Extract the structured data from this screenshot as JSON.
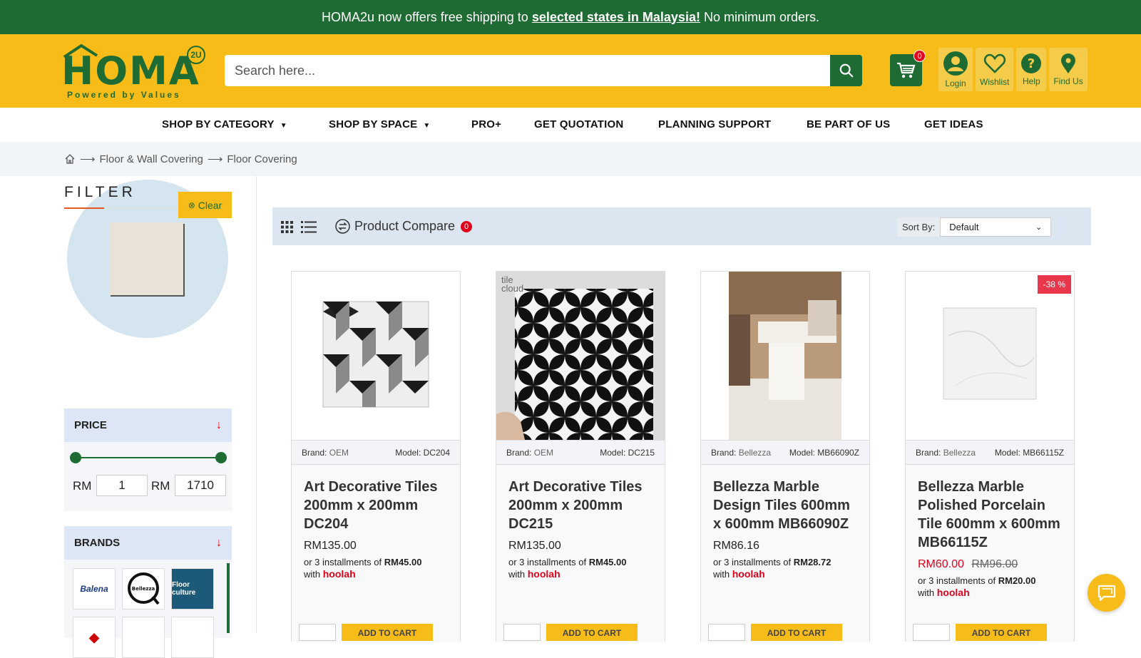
{
  "announcement": {
    "prefix": "HOMA2u now offers free shipping to",
    "link": "selected states in Malaysia!",
    "suffix": "No minimum orders."
  },
  "header": {
    "logo_text": "HOMA",
    "logo_badge": "2U",
    "logo_tagline": "Powered by Values",
    "search_placeholder": "Search here...",
    "cart_count": "0",
    "icons": [
      {
        "label": "Login",
        "icon": "user-icon"
      },
      {
        "label": "Wishlist",
        "icon": "heart-icon"
      },
      {
        "label": "Help",
        "icon": "help-icon"
      },
      {
        "label": "Find Us",
        "icon": "location-pin-icon"
      }
    ]
  },
  "nav": {
    "items": [
      "SHOP BY CATEGORY",
      "SHOP BY SPACE",
      "PRO+",
      "GET QUOTATION",
      "PLANNING SUPPORT",
      "BE PART OF US",
      "GET IDEAS"
    ]
  },
  "breadcrumb": [
    "Floor & Wall Covering",
    "Floor Covering"
  ],
  "filter": {
    "title": "FILTER",
    "clear": "Clear",
    "price": {
      "heading": "PRICE",
      "currency": "RM",
      "min": "1",
      "max": "1710"
    },
    "brands": {
      "heading": "BRANDS",
      "logos": [
        "Balena",
        "Bellezza",
        "Floor culture"
      ]
    }
  },
  "toolbar": {
    "compare_label": "Product Compare",
    "compare_count": "0",
    "sort_label": "Sort By:",
    "sort_value": "Default"
  },
  "products": [
    {
      "brand_label": "Brand:",
      "brand": "OEM",
      "model_label": "Model:",
      "model": "DC204",
      "title": "Art Decorative Tiles 200mm x 200mm DC204",
      "price": "RM135.00",
      "installment_prefix": "or 3 installments of",
      "installment": "RM45.00",
      "with": "with",
      "provider": "hoolah",
      "add_to_cart": "ADD TO CART"
    },
    {
      "brand_label": "Brand:",
      "brand": "OEM",
      "model_label": "Model:",
      "model": "DC215",
      "title": "Art Decorative Tiles 200mm x 200mm DC215",
      "price": "RM135.00",
      "installment_prefix": "or 3 installments of",
      "installment": "RM45.00",
      "with": "with",
      "provider": "hoolah",
      "add_to_cart": "ADD TO CART",
      "watermark": "tile cloud"
    },
    {
      "brand_label": "Brand:",
      "brand": "Bellezza",
      "model_label": "Model:",
      "model": "MB66090Z",
      "title": "Bellezza Marble Design Tiles 600mm x 600mm MB66090Z",
      "price": "RM86.16",
      "installment_prefix": "or 3 installments of",
      "installment": "RM28.72",
      "with": "with",
      "provider": "hoolah",
      "add_to_cart": "ADD TO CART"
    },
    {
      "brand_label": "Brand:",
      "brand": "Bellezza",
      "model_label": "Model:",
      "model": "MB66115Z",
      "title": "Bellezza Marble Polished Porcelain Tile 600mm x 600mm MB66115Z",
      "sale_price": "RM60.00",
      "old_price": "RM96.00",
      "discount": "-38 %",
      "installment_prefix": "or 3 installments of",
      "installment": "RM20.00",
      "with": "with",
      "provider": "hoolah",
      "add_to_cart": "ADD TO CART"
    }
  ],
  "colors": {
    "brand_green": "#1e6b34",
    "brand_yellow": "#f7bc17",
    "sale_red": "#e3001b"
  }
}
